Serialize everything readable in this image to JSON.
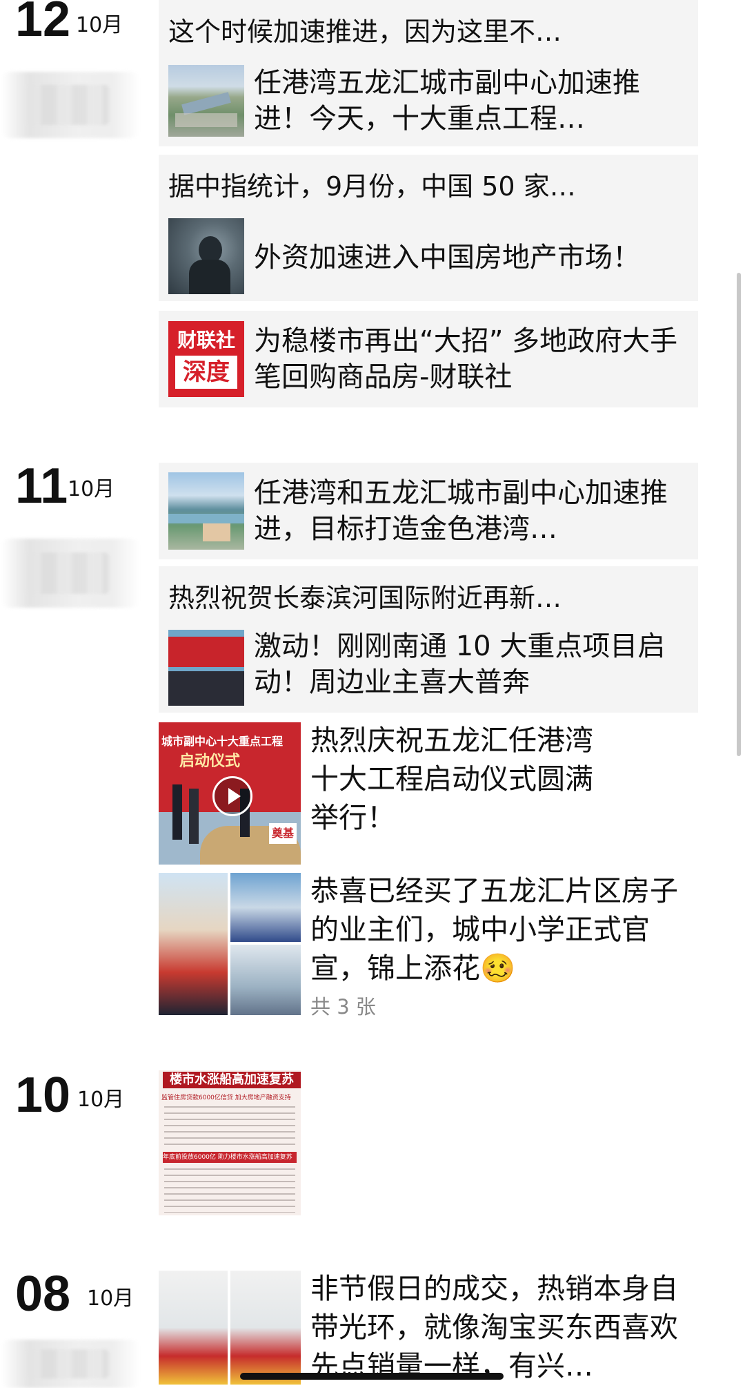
{
  "days": [
    {
      "day": "12",
      "month": "10月"
    },
    {
      "day": "11",
      "month": "10月"
    },
    {
      "day": "10",
      "month": "10月"
    },
    {
      "day": "08",
      "month": "10月"
    }
  ],
  "blurred_user_tail": "读汀...",
  "posts": {
    "p1": {
      "title": "这个时候加速推进，因为这里不…",
      "link_title": "任港湾五龙汇城市副中心加速推进！今天，十大重点工程…"
    },
    "p2": {
      "title": "据中指统计，9月份，中国 50 家…",
      "link_title": "外资加速进入中国房地产市场！"
    },
    "p3": {
      "logo_top": "财联社",
      "logo_bottom": "深度",
      "link_title": "为稳楼市再出“大招” 多地政府大手笔回购商品房-财联社"
    },
    "p4": {
      "link_title": "任港湾和五龙汇城市副中心加速推进，目标打造金色港湾…"
    },
    "p5": {
      "title": "热烈祝贺长泰滨河国际附近再新…",
      "link_title": "激动！刚刚南通 10 大重点项目启动！周边业主喜大普奔"
    },
    "p6": {
      "text": "热烈庆祝五龙汇任港湾十大工程启动仪式圆满举行！",
      "video_banner": "城市副中心十大重点工程",
      "video_banner2": "启动仪式",
      "stone": "奠基"
    },
    "p7": {
      "text": "恭喜已经买了五龙汇片区房子的业主们，城中小学正式官宣，锦上添花🥴",
      "count": "共 3 张"
    },
    "p8": {
      "headline": "楼市水涨船高加速复苏",
      "subhead": "监管住房贷款6000亿信贷 加大房地产融资支持",
      "section": "年底前投放6000亿 助力楼市水涨船高加速复苏"
    },
    "p9": {
      "text": "非节假日的成交，热销本身自带光环，就像淘宝买东西喜欢先点销量一样，有兴…"
    }
  },
  "colors": {
    "card_bg": "#f4f4f4",
    "accent_red": "#d6202a",
    "muted": "#888888"
  },
  "icons": [
    "play-icon"
  ]
}
